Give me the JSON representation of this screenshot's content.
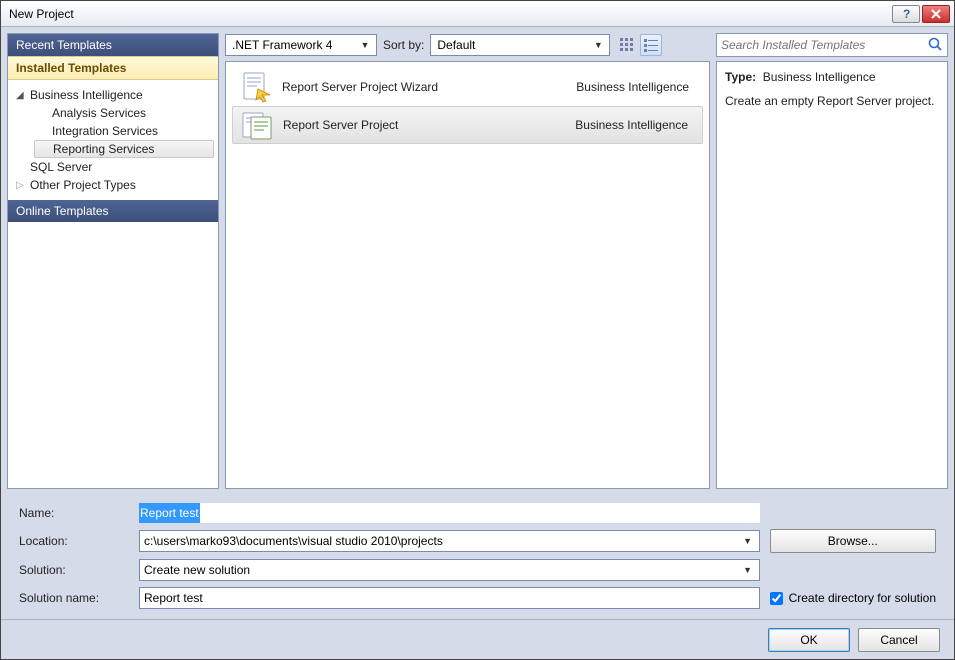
{
  "window": {
    "title": "New Project"
  },
  "sidebar": {
    "recent": "Recent Templates",
    "installed": "Installed Templates",
    "online": "Online Templates",
    "tree": {
      "bi": "Business Intelligence",
      "analysis": "Analysis Services",
      "integration": "Integration Services",
      "reporting": "Reporting Services",
      "sql": "SQL Server",
      "other": "Other Project Types"
    }
  },
  "toolbar": {
    "framework": ".NET Framework 4",
    "sortby_label": "Sort by:",
    "sortby_value": "Default"
  },
  "search": {
    "placeholder": "Search Installed Templates"
  },
  "templates": [
    {
      "name": "Report Server Project Wizard",
      "category": "Business Intelligence",
      "selected": false
    },
    {
      "name": "Report Server Project",
      "category": "Business Intelligence",
      "selected": true
    }
  ],
  "details": {
    "type_label": "Type:",
    "type_value": "Business Intelligence",
    "description": "Create an empty Report Server project."
  },
  "form": {
    "name_label": "Name:",
    "name_value": "Report test",
    "location_label": "Location:",
    "location_value": "c:\\users\\marko93\\documents\\visual studio 2010\\projects",
    "browse": "Browse...",
    "solution_label": "Solution:",
    "solution_value": "Create new solution",
    "solutionname_label": "Solution name:",
    "solutionname_value": "Report test",
    "createdir_label": "Create directory for solution",
    "createdir_checked": true
  },
  "buttons": {
    "ok": "OK",
    "cancel": "Cancel"
  }
}
